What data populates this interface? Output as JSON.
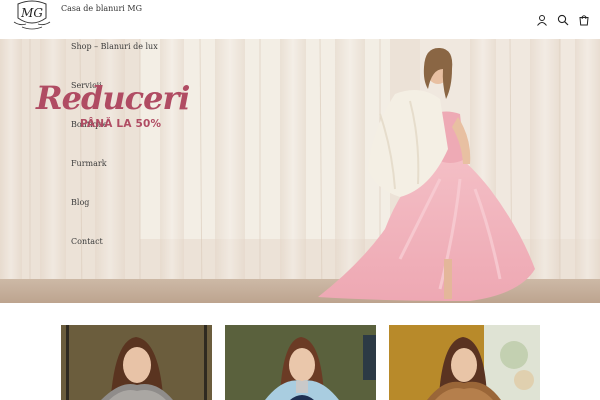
{
  "header": {
    "brand": "Casa de blanuri MG",
    "logo_text": "MG",
    "icons": [
      "account-icon",
      "search-icon",
      "cart-icon"
    ]
  },
  "nav": {
    "items": [
      {
        "label": "Shop – Blanuri de lux"
      },
      {
        "label": "Servicii"
      },
      {
        "label": "Boutique"
      },
      {
        "label": "Furmark"
      },
      {
        "label": "Blog"
      },
      {
        "label": "Contact"
      }
    ]
  },
  "hero": {
    "title": "Reduceri",
    "subtitle": "PÂNĂ LA 50%",
    "accent_color": "#b04c63"
  },
  "gallery": {
    "cards": [
      {
        "name": "product-card-1"
      },
      {
        "name": "product-card-2"
      },
      {
        "name": "product-card-3"
      }
    ]
  }
}
